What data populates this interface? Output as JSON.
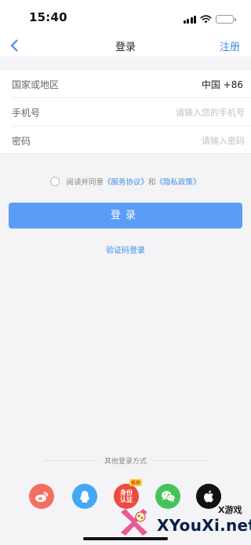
{
  "status_bar": {
    "time": "15:40"
  },
  "nav": {
    "title": "登录",
    "register_label": "注册"
  },
  "form": {
    "region_label": "国家或地区",
    "region_value": "中国 +86",
    "phone_label": "手机号",
    "phone_placeholder": "请输入您的手机号",
    "password_label": "密码",
    "password_placeholder": "请输入密码"
  },
  "agreement": {
    "prefix": "阅读并同意",
    "service_link": "《服务协议》",
    "conjunction": "和",
    "privacy_link": "《隐私政策》"
  },
  "login_button_label": "登录",
  "sms_login_label": "验证码登录",
  "other_login": {
    "title": "其他登录方式",
    "id_badge": "推荐",
    "id_text_line1": "身份",
    "id_text_line2": "认证"
  },
  "watermark": {
    "sub": "X游戏",
    "main": "XYouXi.net"
  },
  "colors": {
    "accent": "#3a8ee6",
    "button": "#5a9cf6",
    "background": "#f4f4f6"
  },
  "icons": [
    "back-chevron-icon",
    "weibo-icon",
    "qq-icon",
    "id-auth-icon",
    "wechat-icon",
    "apple-icon"
  ]
}
